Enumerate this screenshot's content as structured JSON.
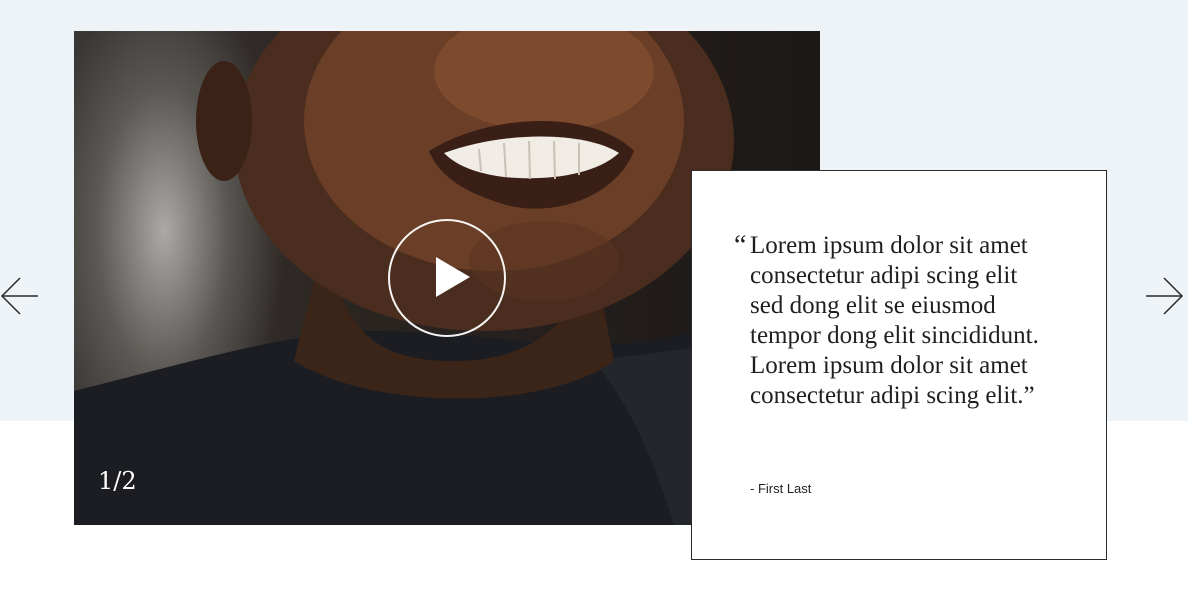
{
  "slider": {
    "counter": "1/2",
    "prev_icon": "arrow-left-icon",
    "next_icon": "arrow-right-icon",
    "play_icon": "play-icon"
  },
  "testimonial": {
    "open_quote": "“",
    "quote": "Lorem ipsum dolor sit amet consectetur adipi scing elit sed dong elit se eiusmod tempor dong elit sincididunt. Lorem ipsum dolor sit amet consectetur adipi scing elit.”",
    "author": "- First Last"
  },
  "colors": {
    "band_background": "#edf3f7",
    "card_border": "#2b2b2b",
    "text": "#1f1f1f"
  }
}
